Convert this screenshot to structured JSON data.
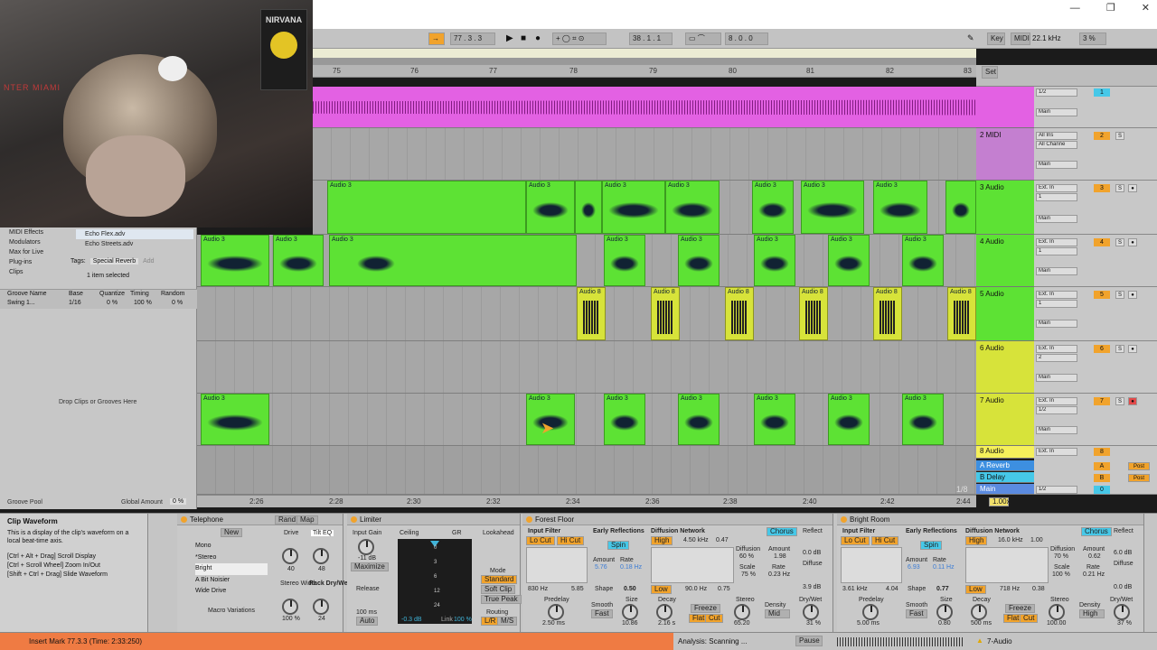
{
  "transport": {
    "tempo": "77 . 3 . 3",
    "position": "38 . 1 . 1",
    "loop_length": "8 . 0 . 0",
    "key_label": "Key",
    "midi_label": "MIDI",
    "sample_rate": "22.1 kHz",
    "cpu": "3 %"
  },
  "arrangement": {
    "bar_numbers": [
      "75",
      "76",
      "77",
      "78",
      "79",
      "80",
      "81",
      "82",
      "83"
    ],
    "time_labels": [
      "2:26",
      "2:28",
      "2:30",
      "2:32",
      "2:34",
      "2:36",
      "2:38",
      "2:40",
      "2:42",
      "2:44"
    ],
    "set_label": "Set",
    "zoom_ratio": "1/8",
    "zoom_value": "1.00x"
  },
  "tracks": [
    {
      "name": "",
      "number": "1",
      "input": "1/2",
      "output": "Main",
      "sub": "Auto",
      "color": "#e361e3"
    },
    {
      "name": "2 MIDI",
      "number": "2",
      "input": "All Ins",
      "input2": "All Channe",
      "output": "Main",
      "sub": "Auto",
      "color": "#c47fd0"
    },
    {
      "name": "3 Audio",
      "number": "3",
      "input": "Ext. In",
      "input2": "1",
      "output": "Main",
      "sub": "Auto",
      "color": "#5de234"
    },
    {
      "name": "4 Audio",
      "number": "4",
      "input": "Ext. In",
      "input2": "1",
      "output": "Main",
      "sub": "Auto",
      "color": "#5de234"
    },
    {
      "name": "5 Audio",
      "number": "5",
      "input": "Ext. In",
      "input2": "1",
      "output": "Main",
      "sub": "Auto",
      "color": "#5de234"
    },
    {
      "name": "6 Audio",
      "number": "6",
      "input": "Ext. In",
      "input2": "2",
      "output": "Main",
      "sub": "Auto",
      "color": "#d7e33a"
    },
    {
      "name": "7 Audio",
      "number": "7",
      "input": "Ext. In",
      "input2": "1/2",
      "output": "Main",
      "sub": "Auto",
      "color": "#d7e33a"
    },
    {
      "name": "8 Audio",
      "number": "8",
      "input": "Ext. In",
      "color": "#f5f05a"
    },
    {
      "name": "A Reverb",
      "number": "A",
      "send": "Post",
      "color": "#3d8fe0"
    },
    {
      "name": "B Delay",
      "number": "B",
      "send": "Post",
      "color": "#46c8e8"
    },
    {
      "name": "Main",
      "number": "0",
      "input": "1/2",
      "color": "#5b8be0"
    }
  ],
  "clip_labels": {
    "audio3": "Audio 3",
    "audio8": "Audio 8",
    "audio": "Audio"
  },
  "browser": {
    "places": [
      "MIDI Effects",
      "Modulators",
      "Max for Live",
      "Plug-ins",
      "Clips"
    ],
    "files": [
      "Echo Flex.adv",
      "Echo Streets.adv"
    ],
    "tags_label": "Tags:",
    "tag": "Special Reverb",
    "tag_add": "Add",
    "selection": "1 item selected"
  },
  "groove": {
    "headers": [
      "Groove Name",
      "Base",
      "Quantize",
      "Timing",
      "Random"
    ],
    "row": {
      "name": "Swing 1...",
      "base": "1/16",
      "quantize": "0 %",
      "timing": "100 %",
      "random": "0 %"
    },
    "drop_text": "Drop Clips or Grooves Here",
    "pool_label": "Groove Pool",
    "global_label": "Global Amount",
    "global_value": "0 %"
  },
  "info": {
    "title": "Clip Waveform",
    "body": "This is a display of the clip's waveform on a local beat-time axis.",
    "tips": [
      "[Ctrl + Alt + Drag] Scroll Display",
      "[Ctrl + Scroll Wheel] Zoom In/Out",
      "[Shift + Ctrl + Drag] Slide Waveform"
    ]
  },
  "telephone": {
    "title": "Telephone",
    "rand": "Rand",
    "map": "Map",
    "new_label": "New",
    "macros": [
      "Mono",
      "*Stereo",
      "Bright",
      "A Bit Noisier",
      "Wide Drive"
    ],
    "variations": "Macro Variations",
    "knobs": [
      {
        "label": "Drive",
        "value": "40"
      },
      {
        "label": "Tilt EQ",
        "value": "48"
      },
      {
        "label": "Stereo Width",
        "value": "100 %"
      },
      {
        "label": "Rack Dry/Wet",
        "value": "24"
      }
    ]
  },
  "limiter": {
    "title": "Limiter",
    "input_gain": "Input Gain",
    "input_val": "-11 dB",
    "maximize": "Maximize",
    "ceiling": "Ceiling",
    "gr": "GR",
    "release": "Release",
    "release_val": "100 ms",
    "auto": "Auto",
    "meter_val": "-0.3 dB",
    "link": "Link",
    "link_val": "100 %",
    "lookahead": "Lookahead",
    "mode": "Mode",
    "modes": [
      "Standard",
      "Soft Clip",
      "True Peak"
    ],
    "routing": "Routing",
    "routing_opts": [
      "L/R",
      "M/S"
    ],
    "scale": [
      "0",
      "3",
      "6",
      "12",
      "24"
    ]
  },
  "forest": {
    "title": "Forest Floor",
    "input_filter": "Input Filter",
    "lo_cut": "Lo Cut",
    "hi_cut": "Hi Cut",
    "freq_low": "830 Hz",
    "freq_high": "5.85",
    "early": "Early Reflections",
    "spin": "Spin",
    "amount": "Amount",
    "amount_val": "5.76",
    "rate": "Rate",
    "rate_val": "0.18 Hz",
    "shape": "Shape",
    "shape_val": "0.50",
    "diffusion": "Diffusion Network",
    "high": "High",
    "high_freq": "4.50 kHz",
    "high_val": "0.47",
    "low": "Low",
    "low_freq": "90.0 Hz",
    "low_val": "0.75",
    "diff_label": "Diffusion",
    "diff_val": "60 %",
    "scale": "Scale",
    "scale_val": "75 %",
    "chorus": "Chorus",
    "ch_amount": "1.98",
    "ch_rate": "0.23 Hz",
    "reflect": "Reflect",
    "reflect_val": "0.0 dB",
    "diff2": "Diffuse",
    "diff2_val": "3.9 dB",
    "predelay": "Predelay",
    "predelay_val": "2.50 ms",
    "smooth": "Smooth",
    "smooth_val": "Fast",
    "size": "Size",
    "size_val": "10.86",
    "decay": "Decay",
    "decay_val": "2.16 s",
    "freeze": "Freeze",
    "flat": "Flat",
    "cut": "Cut",
    "stereo": "Stereo",
    "stereo_val": "65.20",
    "density": "Density",
    "density_val": "Mid",
    "drywet": "Dry/Wet",
    "drywet_val": "31 %"
  },
  "bright": {
    "title": "Bright Room",
    "freq_low": "3.61 kHz",
    "freq_high": "4.04",
    "amount_val": "6.93",
    "rate_val": "0.11 Hz",
    "shape_val": "0.77",
    "high_freq": "16.0 kHz",
    "high_val": "1.00",
    "low_freq": "718 Hz",
    "low_val": "0.38",
    "diff_val": "70 %",
    "scale_val": "100 %",
    "ch_amount": "0.62",
    "ch_rate": "0.21 Hz",
    "reflect_val": "6.0 dB",
    "diff2_val": "0.0 dB",
    "predelay_val": "5.00 ms",
    "smooth_val": "Fast",
    "size_val": "0.80",
    "decay_val": "500 ms",
    "stereo_val": "100.00",
    "density_val": "High",
    "drywet_val": "37 %"
  },
  "status": {
    "insert_mark": "Insert Mark 77.3.3 (Time: 2:33:250)",
    "analysis": "Analysis: Scanning ...",
    "pause": "Pause",
    "track": "7-Audio"
  }
}
